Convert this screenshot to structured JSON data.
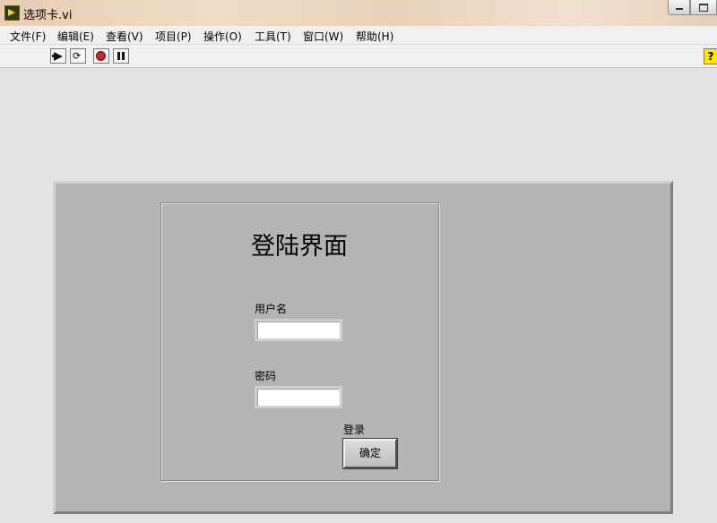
{
  "window": {
    "title": "选项卡.vi"
  },
  "menu": {
    "items": [
      {
        "label": "文件(F)"
      },
      {
        "label": "编辑(E)"
      },
      {
        "label": "查看(V)"
      },
      {
        "label": "项目(P)"
      },
      {
        "label": "操作(O)"
      },
      {
        "label": "工具(T)"
      },
      {
        "label": "窗口(W)"
      },
      {
        "label": "帮助(H)"
      }
    ]
  },
  "toolbar": {
    "icons": [
      "run-arrow-icon",
      "run-continuously-icon",
      "abort-icon",
      "pause-icon",
      "context-help-icon"
    ],
    "help_glyph": "?"
  },
  "login": {
    "heading": "登陆界面",
    "username_label": "用户名",
    "username_value": "",
    "password_label": "密码",
    "password_value": "",
    "login_label": "登录",
    "ok_button": "确定"
  },
  "colors": {
    "panel": "#b4b4b4",
    "background": "#e3e3e3",
    "abort": "#c8282c",
    "help": "#ffe800"
  }
}
